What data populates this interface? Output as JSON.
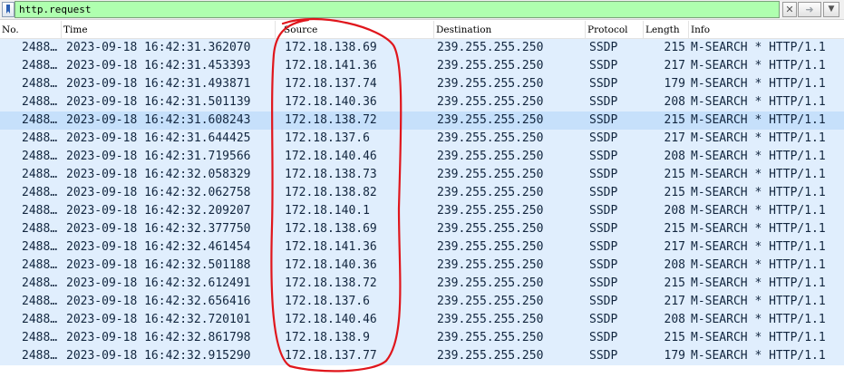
{
  "filter": {
    "value": "http.request"
  },
  "toolbar": {
    "bookmark_icon": "bookmark-icon",
    "clear_glyph": "✕",
    "apply_glyph": "➜",
    "dropdown_glyph": "▼"
  },
  "columns": [
    "No.",
    "Time",
    "Source",
    "Destination",
    "Protocol",
    "Length",
    "Info"
  ],
  "rows": [
    {
      "no": "2488…",
      "time": "2023-09-18 16:42:31.362070",
      "src": "172.18.138.69",
      "dst": "239.255.255.250",
      "proto": "SSDP",
      "len": "215",
      "info": "M-SEARCH * HTTP/1.1"
    },
    {
      "no": "2488…",
      "time": "2023-09-18 16:42:31.453393",
      "src": "172.18.141.36",
      "dst": "239.255.255.250",
      "proto": "SSDP",
      "len": "217",
      "info": "M-SEARCH * HTTP/1.1"
    },
    {
      "no": "2488…",
      "time": "2023-09-18 16:42:31.493871",
      "src": "172.18.137.74",
      "dst": "239.255.255.250",
      "proto": "SSDP",
      "len": "179",
      "info": "M-SEARCH * HTTP/1.1"
    },
    {
      "no": "2488…",
      "time": "2023-09-18 16:42:31.501139",
      "src": "172.18.140.36",
      "dst": "239.255.255.250",
      "proto": "SSDP",
      "len": "208",
      "info": "M-SEARCH * HTTP/1.1"
    },
    {
      "no": "2488…",
      "time": "2023-09-18 16:42:31.608243",
      "src": "172.18.138.72",
      "dst": "239.255.255.250",
      "proto": "SSDP",
      "len": "215",
      "info": "M-SEARCH * HTTP/1.1"
    },
    {
      "no": "2488…",
      "time": "2023-09-18 16:42:31.644425",
      "src": "172.18.137.6",
      "dst": "239.255.255.250",
      "proto": "SSDP",
      "len": "217",
      "info": "M-SEARCH * HTTP/1.1"
    },
    {
      "no": "2488…",
      "time": "2023-09-18 16:42:31.719566",
      "src": "172.18.140.46",
      "dst": "239.255.255.250",
      "proto": "SSDP",
      "len": "208",
      "info": "M-SEARCH * HTTP/1.1"
    },
    {
      "no": "2488…",
      "time": "2023-09-18 16:42:32.058329",
      "src": "172.18.138.73",
      "dst": "239.255.255.250",
      "proto": "SSDP",
      "len": "215",
      "info": "M-SEARCH * HTTP/1.1"
    },
    {
      "no": "2488…",
      "time": "2023-09-18 16:42:32.062758",
      "src": "172.18.138.82",
      "dst": "239.255.255.250",
      "proto": "SSDP",
      "len": "215",
      "info": "M-SEARCH * HTTP/1.1"
    },
    {
      "no": "2488…",
      "time": "2023-09-18 16:42:32.209207",
      "src": "172.18.140.1",
      "dst": "239.255.255.250",
      "proto": "SSDP",
      "len": "208",
      "info": "M-SEARCH * HTTP/1.1"
    },
    {
      "no": "2488…",
      "time": "2023-09-18 16:42:32.377750",
      "src": "172.18.138.69",
      "dst": "239.255.255.250",
      "proto": "SSDP",
      "len": "215",
      "info": "M-SEARCH * HTTP/1.1"
    },
    {
      "no": "2488…",
      "time": "2023-09-18 16:42:32.461454",
      "src": "172.18.141.36",
      "dst": "239.255.255.250",
      "proto": "SSDP",
      "len": "217",
      "info": "M-SEARCH * HTTP/1.1"
    },
    {
      "no": "2488…",
      "time": "2023-09-18 16:42:32.501188",
      "src": "172.18.140.36",
      "dst": "239.255.255.250",
      "proto": "SSDP",
      "len": "208",
      "info": "M-SEARCH * HTTP/1.1"
    },
    {
      "no": "2488…",
      "time": "2023-09-18 16:42:32.612491",
      "src": "172.18.138.72",
      "dst": "239.255.255.250",
      "proto": "SSDP",
      "len": "215",
      "info": "M-SEARCH * HTTP/1.1"
    },
    {
      "no": "2488…",
      "time": "2023-09-18 16:42:32.656416",
      "src": "172.18.137.6",
      "dst": "239.255.255.250",
      "proto": "SSDP",
      "len": "217",
      "info": "M-SEARCH * HTTP/1.1"
    },
    {
      "no": "2488…",
      "time": "2023-09-18 16:42:32.720101",
      "src": "172.18.140.46",
      "dst": "239.255.255.250",
      "proto": "SSDP",
      "len": "208",
      "info": "M-SEARCH * HTTP/1.1"
    },
    {
      "no": "2488…",
      "time": "2023-09-18 16:42:32.861798",
      "src": "172.18.138.9",
      "dst": "239.255.255.250",
      "proto": "SSDP",
      "len": "215",
      "info": "M-SEARCH * HTTP/1.1"
    },
    {
      "no": "2488…",
      "time": "2023-09-18 16:42:32.915290",
      "src": "172.18.137.77",
      "dst": "239.255.255.250",
      "proto": "SSDP",
      "len": "179",
      "info": "M-SEARCH * HTTP/1.1"
    }
  ],
  "selected_row": 4,
  "colors": {
    "filter_valid_bg": "#afffaf",
    "row_bg": "#e0eefd",
    "row_selected_bg": "#c6e0fb",
    "annotation": "#e0161c"
  }
}
